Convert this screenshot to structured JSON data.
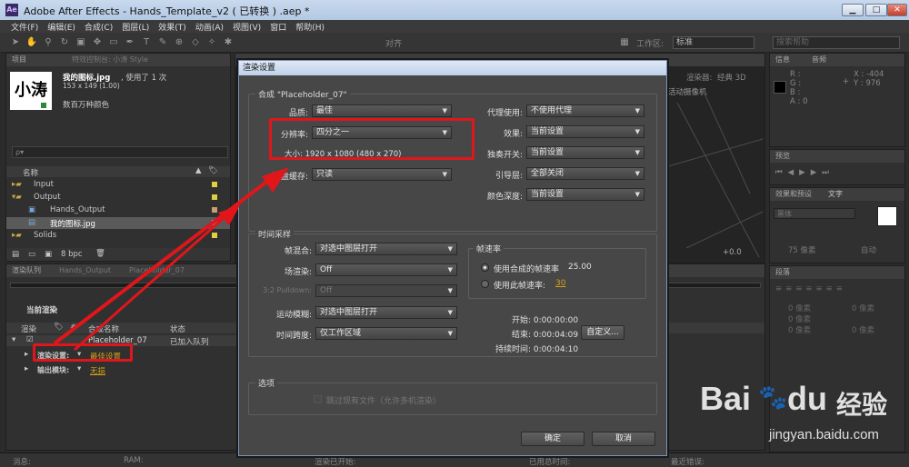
{
  "titlebar": {
    "app_icon": "Ae",
    "title": "Adobe After Effects - Hands_Template_v2 ( 已转换 ) .aep *",
    "min": "▁",
    "max": "□",
    "close": "✕"
  },
  "menu": [
    "文件(F)",
    "编辑(E)",
    "合成(C)",
    "图层(L)",
    "效果(T)",
    "动画(A)",
    "视图(V)",
    "窗口",
    "帮助(H)"
  ],
  "toolbar": {
    "align_label": "对齐",
    "workspace_label": "工作区:",
    "workspace_value": "标准",
    "search_placeholder": "搜索帮助"
  },
  "project": {
    "tab": "项目",
    "tab2": "特效控制台: 小涛 Style",
    "item_name": "我的图标.jpg",
    "item_usage": ", 使用了 1 次",
    "item_dims": "153 x 149 (1.00)",
    "item_colors": "数百万种颜色",
    "thumb_text": "小涛",
    "search_placeholder": "ρ▾",
    "col_name": "名称",
    "tree": [
      {
        "label": "Input",
        "indent": 0,
        "type": "folder"
      },
      {
        "label": "Output",
        "indent": 0,
        "type": "folder-open"
      },
      {
        "label": "Hands_Output",
        "indent": 1,
        "type": "comp"
      },
      {
        "label": "我的图标.jpg",
        "indent": 1,
        "type": "image",
        "selected": true
      },
      {
        "label": "Solids",
        "indent": 0,
        "type": "folder"
      }
    ],
    "bpc": "8 bpc"
  },
  "render_queue": {
    "tabs": [
      "渲染队列",
      "Hands_Output",
      "Placeholder_07"
    ],
    "current_render": "当前渲染",
    "cols": [
      "渲染",
      "#",
      "合成名称",
      "状态"
    ],
    "row_name": "Placeholder_07",
    "row_status": "已加入队列",
    "render_settings_label": "渲染设置:",
    "render_settings_value": "最佳设置",
    "output_module_label": "输出模块:",
    "output_module_value": "无损"
  },
  "status_bar": {
    "msg": "消息:",
    "ram": "RAM:",
    "started": "渲染已开始:",
    "elapsed": "已用总时间:",
    "errors": "最近错误:"
  },
  "right_panels": {
    "info_tab": "信息",
    "audio_tab": "音频",
    "info_lines": [
      "R :",
      "G :",
      "B :",
      "A : 0"
    ],
    "xy": [
      "X : -404",
      "Y : 976"
    ],
    "preview_tab": "预览",
    "effects_tab": "效果和预设",
    "char_tab": "文字",
    "font": "黑体",
    "size": "75 像素",
    "auto": "自动",
    "para_tab": "段落",
    "para_vals": [
      "0 像素",
      "0 像素",
      "0 像素",
      "0 像素",
      "0 像素"
    ]
  },
  "comp_viewer": {
    "renderer": "渲染器:",
    "camera": "活动摄像机",
    "view": "经典 3D",
    "zoom": "+0.0"
  },
  "dialog": {
    "title": "渲染设置",
    "comp_group": "合成 \"Placeholder_07\"",
    "quality_label": "品质:",
    "quality_value": "最佳",
    "resolution_label": "分辨率:",
    "resolution_value": "四分之一",
    "size_text": "大小: 1920 x 1080 (480 x 270)",
    "disk_cache_label": "磁盘缓存:",
    "disk_cache_value": "只读",
    "proxy_label": "代理使用:",
    "proxy_value": "不使用代理",
    "effects_label": "效果:",
    "effects_value": "当前设置",
    "solo_label": "独奏开关:",
    "solo_value": "当前设置",
    "guide_label": "引导层:",
    "guide_value": "全部关闭",
    "depth_label": "颜色深度:",
    "depth_value": "当前设置",
    "time_group": "时间采样",
    "frame_blend_label": "帧混合:",
    "frame_blend_value": "对选中图层打开",
    "field_label": "场渲染:",
    "field_value": "Off",
    "pulldown_label": "3:2 Pulldown:",
    "pulldown_value": "Off",
    "motion_blur_label": "运动模糊:",
    "motion_blur_value": "对选中图层打开",
    "time_span_label": "时间跨度:",
    "time_span_value": "仅工作区域",
    "fps_group": "帧速率",
    "fps_use_comp": "使用合成的帧速率",
    "fps_comp_value": "25.00",
    "fps_use_this": "使用此帧速率:",
    "fps_this_value": "30",
    "start": "开始: 0:00:00:00",
    "end": "结束: 0:00:04:09",
    "custom_btn": "自定义...",
    "duration": "持续时间: 0:00:04:10",
    "options_group": "选项",
    "skip_existing": "跳过现有文件（允许多机渲染）",
    "ok": "确定",
    "cancel": "取消"
  },
  "watermark": {
    "text": "Bai",
    "paw": "🐾",
    "du": "du",
    "cn": "经验",
    "url": "jingyan.baidu.com"
  },
  "colors": {
    "highlight": "#e0161b",
    "accent_link": "#d4a017",
    "dialog_bg": "#474747"
  }
}
